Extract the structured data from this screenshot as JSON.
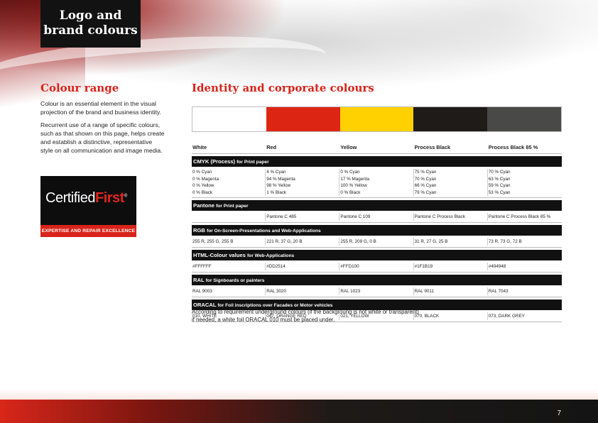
{
  "header": {
    "title_line1": "Logo and",
    "title_line2": "brand colours"
  },
  "left": {
    "heading": "Colour range",
    "paragraph1": "Colour is an essential element in the visual projection of the brand and business identity.",
    "paragraph2": "Recurrent use of a range of specific colours, such as that shown on this page, helps create and establish a distinctive, representative style on all communication and image media.",
    "logo": {
      "word1": "Certified",
      "word2": "First",
      "reg": "®",
      "tagline": "EXPERTISE AND REPAIR EXCELLENCE"
    }
  },
  "right": {
    "heading": "Identity and corporate colours",
    "swatches": [
      "#FFFFFF",
      "#DD2514",
      "#FFD100",
      "#1F1B19",
      "#494948"
    ],
    "columns": [
      "White",
      "Red",
      "Yellow",
      "Process Black",
      "Process Black 85 %"
    ],
    "sections": [
      {
        "title": "CMYK (Process)",
        "subtitle": "for Print paper",
        "values": [
          [
            "0 % Cyan",
            "0 % Magenta",
            "0 % Yellow",
            "0 % Black"
          ],
          [
            "4 % Cyan",
            "94 % Magenta",
            "98 % Yellow",
            "1 % Black"
          ],
          [
            "0 % Cyan",
            "17 % Magenta",
            "100 % Yellow",
            "0 % Black"
          ],
          [
            "75 % Cyan",
            "70 % Cyan",
            "66 % Cyan",
            "79 % Cyan"
          ],
          [
            "70 % Cyan",
            "63 % Cyan",
            "59 % Cyan",
            "53 % Cyan"
          ]
        ]
      },
      {
        "title": "Pantone",
        "subtitle": "for Print paper",
        "values": [
          [
            ""
          ],
          [
            "Pantone C 485"
          ],
          [
            "Pantone C 109"
          ],
          [
            "Pantone C Process Black"
          ],
          [
            "Pantone C Process Black 85 %"
          ]
        ]
      },
      {
        "title": "RGB",
        "subtitle": "for On-Screen-Presentations and Web-Applications",
        "values": [
          [
            "255 R, 255 G, 255 B"
          ],
          [
            "221 R, 37 G, 20 B"
          ],
          [
            "255 R, 209 G, 0 B"
          ],
          [
            "31 R, 27 G, 25 B"
          ],
          [
            "73 R, 73 G, 72 B"
          ]
        ]
      },
      {
        "title": "HTML-Colour values",
        "subtitle": "for Web-Applications",
        "values": [
          [
            "#FFFFFF"
          ],
          [
            "#DD2514"
          ],
          [
            "#FFD100"
          ],
          [
            "#1F1B19"
          ],
          [
            "#494948"
          ]
        ]
      },
      {
        "title": "RAL",
        "subtitle": "for Signboards or painters",
        "values": [
          [
            "RAL 9003"
          ],
          [
            "RAL 3020"
          ],
          [
            "RAL 1023"
          ],
          [
            "RAL 9011"
          ],
          [
            "RAL 7043"
          ]
        ]
      },
      {
        "title": "ORACAL",
        "subtitle": "for Foil inscriptions over Facades or Motor vehicles",
        "values": [
          [
            "010, WHITE"
          ],
          [
            "047, ORANGE RED"
          ],
          [
            "021, YELLOW"
          ],
          [
            "070, BLACK"
          ],
          [
            "073, DARK GREY"
          ]
        ]
      }
    ],
    "note_line1": "According to requirement underground colours (if the backgroung is not white or transparent)",
    "note_line2": "if needed, a white foil ORACAL 010 must be placed under."
  },
  "footer": {
    "page_number": "7"
  }
}
